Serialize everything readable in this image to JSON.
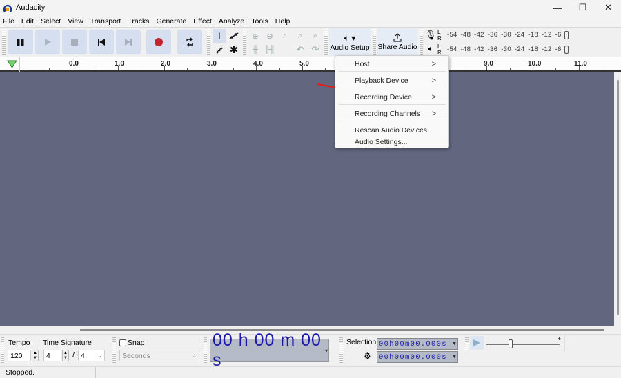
{
  "window": {
    "title": "Audacity",
    "controls": {
      "minimize": "—",
      "maximize": "☐",
      "close": "✕"
    }
  },
  "menu": [
    "File",
    "Edit",
    "Select",
    "View",
    "Transport",
    "Tracks",
    "Generate",
    "Effect",
    "Analyze",
    "Tools",
    "Help"
  ],
  "transport": {
    "buttons": [
      {
        "name": "pause",
        "icon": "pause-icon"
      },
      {
        "name": "play",
        "icon": "play-icon"
      },
      {
        "name": "stop",
        "icon": "stop-icon"
      },
      {
        "name": "skip-start",
        "icon": "skip-start-icon"
      },
      {
        "name": "skip-end",
        "icon": "skip-end-icon"
      },
      {
        "name": "record",
        "icon": "record-icon",
        "color": "#c0282d"
      },
      {
        "name": "loop",
        "icon": "loop-icon"
      }
    ]
  },
  "toolbar": {
    "audio_setup_label": "Audio Setup",
    "share_audio_label": "Share Audio"
  },
  "meters": {
    "record_scale": "-54 -48 -42 -36 -30 -24 -18 -12 -6",
    "playback_scale": "-54 -48 -42 -36 -30 -24 -18 -12 -6",
    "channels": [
      "L",
      "R"
    ]
  },
  "ruler": {
    "labels": [
      "0.0",
      "1.0",
      "2.0",
      "3.0",
      "4.0",
      "5.0",
      "9.0",
      "10.0",
      "11.0"
    ]
  },
  "audio_setup_menu": {
    "items": [
      {
        "label": "Host",
        "submenu": true
      },
      {
        "label": "Playback Device",
        "submenu": true
      },
      {
        "label": "Recording Device",
        "submenu": true
      },
      {
        "label": "Recording Channels",
        "submenu": true
      },
      {
        "label": "Rescan Audio Devices",
        "submenu": false
      },
      {
        "label": "Audio Settings...",
        "submenu": false
      }
    ],
    "arrow": ">"
  },
  "bottom": {
    "tempo_label": "Tempo",
    "tempo_value": "120",
    "time_signature_label": "Time Signature",
    "time_sig_upper": "4",
    "time_sig_separator": "/",
    "time_sig_lower": "4",
    "snap_label": "Snap",
    "snap_checked": false,
    "snap_unit": "Seconds",
    "time_display": "00 h 00 m 00 s",
    "selection_label": "Selection",
    "selection_start": "00h00m00.000s",
    "selection_end": "00h00m00.000s",
    "playback_speed_min": "-",
    "playback_speed_max": "+"
  },
  "status": {
    "text": "Stopped."
  },
  "colors": {
    "track_bg": "#62677f",
    "time_text": "#1a1aa8",
    "record_red": "#c0282d",
    "annotation_arrow": "#e02020"
  }
}
